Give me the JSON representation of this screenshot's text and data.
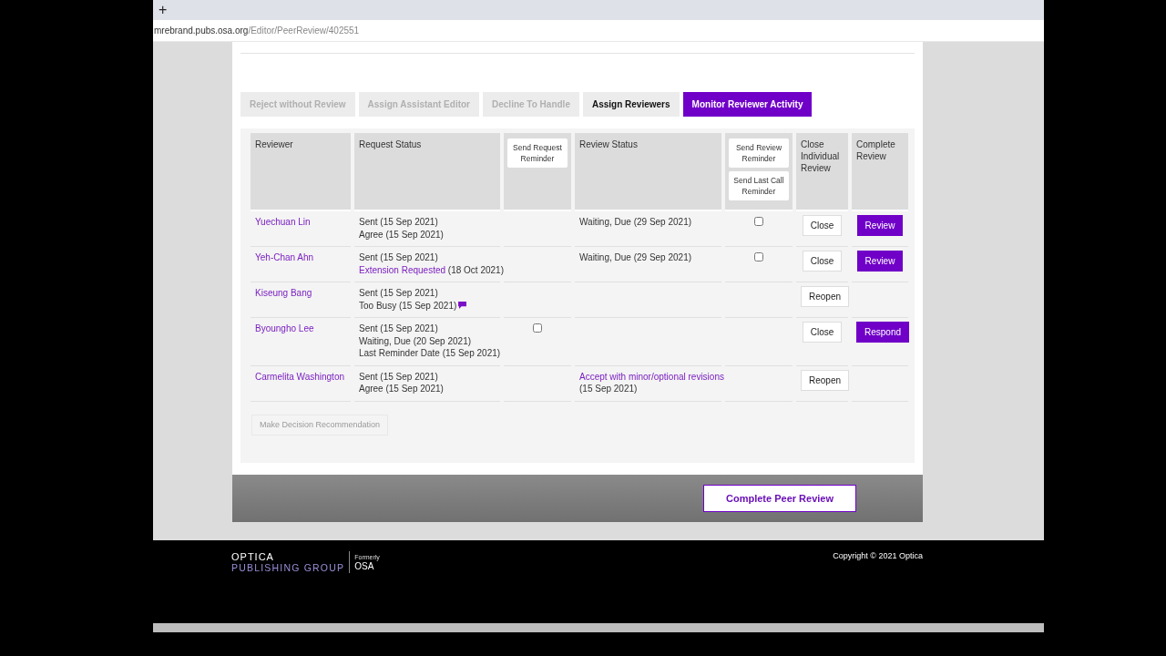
{
  "browser": {
    "new_tab": "+",
    "url_host": "mrebrand.pubs.osa.org",
    "url_path": "/Editor/PeerReview/402551"
  },
  "tabs": [
    {
      "label": "Reject without Review",
      "selected": false,
      "disabled": true
    },
    {
      "label": "Assign Assistant Editor",
      "selected": false,
      "disabled": true
    },
    {
      "label": "Decline To Handle",
      "selected": false,
      "disabled": true
    },
    {
      "label": "Assign Reviewers",
      "selected": false,
      "disabled": false
    },
    {
      "label": "Monitor Reviewer Activity",
      "selected": true,
      "disabled": false
    }
  ],
  "table": {
    "columns": [
      {
        "kind": "text",
        "label": "Reviewer"
      },
      {
        "kind": "text",
        "label": "Request Status"
      },
      {
        "kind": "buttons",
        "buttons": [
          "Send Request Reminder"
        ]
      },
      {
        "kind": "text",
        "label": "Review Status"
      },
      {
        "kind": "buttons",
        "buttons": [
          "Send Review Reminder",
          "Send Last Call Reminder"
        ]
      },
      {
        "kind": "text",
        "label": "Close Individual Review"
      },
      {
        "kind": "text",
        "label": "Complete Review"
      }
    ],
    "rows": [
      {
        "reviewer": "Yuechuan Lin",
        "request_status": [
          {
            "kind": "plain",
            "text": "Sent (15 Sep 2021)"
          },
          {
            "kind": "plain",
            "text": "Agree (15 Sep 2021)"
          }
        ],
        "review_status": [
          {
            "kind": "plain",
            "text": "Waiting, Due (29 Sep 2021)"
          }
        ],
        "review_reminder": {
          "checked": false
        },
        "close_action": "Close",
        "complete_action": "Review"
      },
      {
        "reviewer": "Yeh-Chan Ahn",
        "request_status": [
          {
            "kind": "plain",
            "text": "Sent (15 Sep 2021)"
          },
          {
            "kind": "link",
            "text": "Extension Requested",
            "note": " (18 Oct 2021)"
          }
        ],
        "review_status": [
          {
            "kind": "plain",
            "text": "Waiting, Due (29 Sep 2021)"
          }
        ],
        "review_reminder": {
          "checked": false
        },
        "close_action": "Close",
        "complete_action": "Review"
      },
      {
        "reviewer": "Kiseung Bang",
        "request_status": [
          {
            "kind": "plain",
            "text": "Sent (15 Sep 2021)"
          },
          {
            "kind": "comment",
            "text": "Too Busy (15 Sep 2021)"
          }
        ],
        "close_action": "Reopen"
      },
      {
        "reviewer": "Byoungho Lee",
        "request_status": [
          {
            "kind": "plain",
            "text": "Sent (15 Sep 2021)"
          },
          {
            "kind": "plain",
            "text": "Waiting, Due (20 Sep 2021)"
          },
          {
            "kind": "plain",
            "text": "Last Reminder Date (15 Sep 2021)"
          }
        ],
        "request_reminder": {
          "checked": false
        },
        "close_action": "Close",
        "complete_action": "Respond"
      },
      {
        "reviewer": "Carmelita Washington",
        "request_status": [
          {
            "kind": "plain",
            "text": "Sent (15 Sep 2021)"
          },
          {
            "kind": "plain",
            "text": "Agree (15 Sep 2021)"
          }
        ],
        "review_status": [
          {
            "kind": "link",
            "text": "Accept with minor/optional revisions"
          },
          {
            "kind": "plain",
            "text": "(15 Sep 2021)"
          }
        ],
        "close_action": "Reopen"
      }
    ]
  },
  "decision_button": {
    "label": "Make Decision Recommendation",
    "disabled": true
  },
  "complete_button": "Complete Peer Review",
  "footer": {
    "logo_main": "OPTICA",
    "logo_sub": "PUBLISHING GROUP",
    "formerly": "Formerly",
    "formerly_name": "OSA",
    "copyright": "Copyright © 2021 Optica"
  }
}
